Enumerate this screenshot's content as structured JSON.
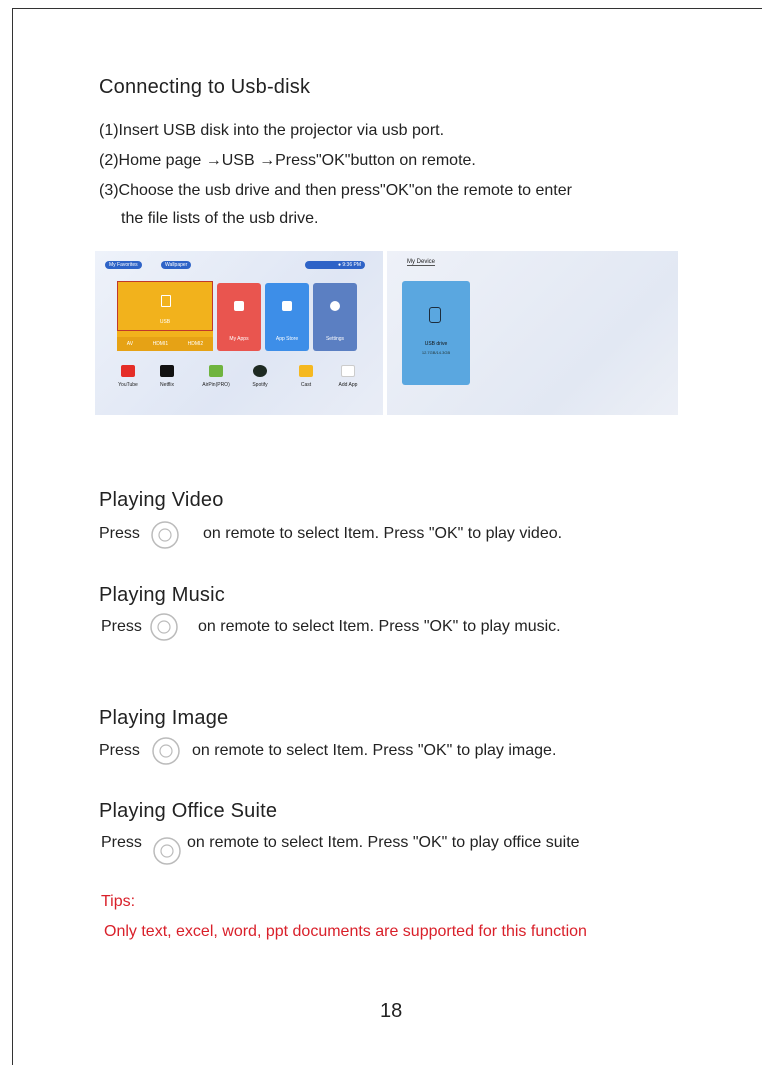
{
  "sections": {
    "usb": {
      "title": "Connecting to Usb-disk",
      "step1": "(1)Insert USB disk into the projector via usb port.",
      "step2": "(2)Home page →USB →Press\"OK\"button on remote.",
      "step3a": "(3)Choose the usb drive and then press\"OK\"on the remote to enter",
      "step3b": "the file lists of the usb drive."
    },
    "video": {
      "title": "Playing Video",
      "press": "Press",
      "text": "on remote to select Item. Press \"OK\" to play video."
    },
    "music": {
      "title": "Playing Music",
      "press": "Press",
      "text": "on remote to select Item. Press \"OK\" to play music."
    },
    "image": {
      "title": "Playing Image",
      "press": "Press",
      "text": "on remote to select Item.   Press \"OK\" to play image."
    },
    "office": {
      "title": "Playing Office Suite",
      "press": "Press",
      "text": "on remote to select Item.   Press \"OK\" to play office suite"
    }
  },
  "tips": {
    "label": "Tips:",
    "text": "Only text, excel, word, ppt documents are supported for this function"
  },
  "page_number": "18",
  "screenshot_home": {
    "pill_favorite": "My Favorites",
    "pill_wallpaper": "Wallpaper",
    "status_time": "9:36 PM",
    "tile_usb": "USB",
    "tile_myapps": "My Apps",
    "tile_appstore": "App Store",
    "tile_settings": "Settings",
    "sub_av": "AV",
    "sub_hdmi1": "HDMI1",
    "sub_hdmi2": "HDMI2",
    "apps": [
      "YouTube",
      "Netflix",
      "AirPin(PRO)",
      "Spotify",
      "Cast",
      "Add App"
    ]
  },
  "screenshot_device": {
    "title": "My Device",
    "drive_name": "USB drive",
    "drive_size": "12.7GB/14.3GB"
  },
  "colors": {
    "accent_red": "#d9202a",
    "usb_tile": "#f2b21c",
    "myapps_tile": "#e9554f",
    "appstore_tile": "#3d8ee8",
    "settings_tile": "#5b7fc2",
    "drive_card": "#5aa7e0"
  }
}
